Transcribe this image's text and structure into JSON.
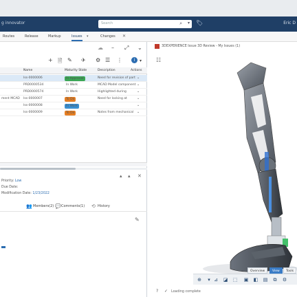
{
  "header": {
    "title": "g innovator",
    "search_placeholder": "Search",
    "user": "Eric D"
  },
  "tabs": [
    {
      "label": "Routes"
    },
    {
      "label": "Release"
    },
    {
      "label": "Markup"
    },
    {
      "label": "Issues"
    },
    {
      "label": "Changes"
    }
  ],
  "grid": {
    "columns": [
      "Name",
      "Maturity State",
      "Description",
      "Actions"
    ],
    "rows": [
      {
        "pre": "",
        "name": "Iss-0000006",
        "state": "In Approval",
        "state_color": "#3aa655",
        "desc": "Need for revision of part"
      },
      {
        "pre": "",
        "name": "PRD0000534",
        "state": "In Work",
        "state_color": "",
        "desc": "MCAD Model component"
      },
      {
        "pre": "",
        "name": "PRD0000574",
        "state": "In Work",
        "state_color": "",
        "desc": "Highlighted during"
      },
      {
        "pre": "ment MCAD",
        "name": "Iss-0000007",
        "state": "To Do",
        "state_color": "#e67e22",
        "desc": "Need for locking at"
      },
      {
        "pre": "",
        "name": "Iss-0000008",
        "state": "In Work",
        "state_color": "#3a8fd1",
        "desc": ""
      },
      {
        "pre": "",
        "name": "Iss-0000009",
        "state": "To Do",
        "state_color": "#e67e22",
        "desc": "Notes from mechanical"
      }
    ]
  },
  "details": {
    "priority_label": "Priority:",
    "priority_value": "Low",
    "due_label": "Due Date:",
    "mod_label": "Modification Date:",
    "mod_value": "1/23/2022",
    "tab_members": "Members(2)",
    "tab_comments": "Comments(1)",
    "tab_history": "History"
  },
  "viewer": {
    "title": "3DEXPERIENCE Issue 3D Review - My Issues (1)",
    "view_buttons": [
      "Overview",
      "View",
      "Tools"
    ],
    "status": "Loading complete"
  }
}
